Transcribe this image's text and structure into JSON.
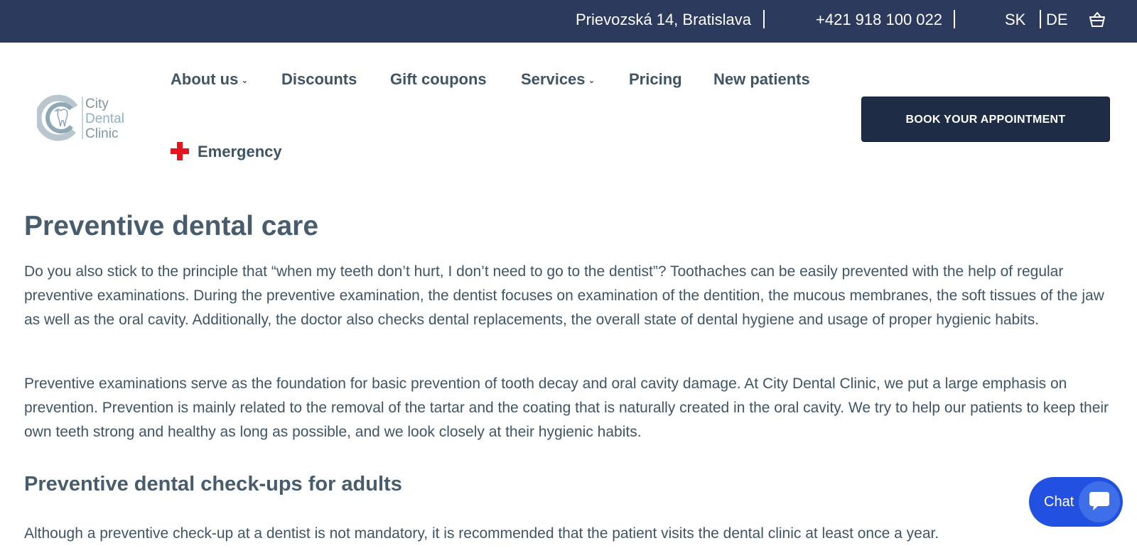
{
  "topbar": {
    "address": "Prievozská 14, Bratislava",
    "phone": "+421 918 100 022",
    "lang_sk": "SK",
    "lang_de": "DE"
  },
  "logo": {
    "line1": "City",
    "line2": "Dental",
    "line3": "Clinic"
  },
  "nav": {
    "about": "About us",
    "discounts": "Discounts",
    "gift": "Gift coupons",
    "services": "Services",
    "pricing": "Pricing",
    "new_patients": "New patients",
    "emergency": "Emergency"
  },
  "book_button": "BOOK YOUR APPOINTMENT",
  "content": {
    "title": "Preventive dental care",
    "p1": "Do you also stick to the principle that “when my teeth don’t hurt, I don’t need to go to the dentist”? Toothaches can be easily prevented with the help of regular preventive examinations. During the preventive examination, the dentist focuses on examination of the dentition, the mucous membranes, the soft tissues of the jaw as well as the oral cavity. Additionally, the doctor also checks dental replacements, the overall state of dental hygiene and usage of proper hygienic habits.",
    "p2": "Preventive examinations serve as the foundation for basic prevention of tooth decay and oral cavity damage. At City Dental Clinic, we put a large emphasis on prevention. Prevention is mainly related to the removal of the tartar and the coating that is naturally created in the oral cavity. We try to help our patients to keep their own teeth strong and healthy as long as possible, and we look closely at their hygienic habits.",
    "subtitle": "Preventive dental check-ups for adults",
    "p3": "Although a preventive check-up at a dentist is not mandatory, it is recommended that the patient visits the dental clinic at least once a year."
  },
  "chat": {
    "label": "Chat"
  },
  "colors": {
    "topbar": "#2c3a5e",
    "button": "#1e2c46",
    "text": "#3f5566",
    "chat": "#2250e0",
    "emergency": "#e5151d"
  }
}
